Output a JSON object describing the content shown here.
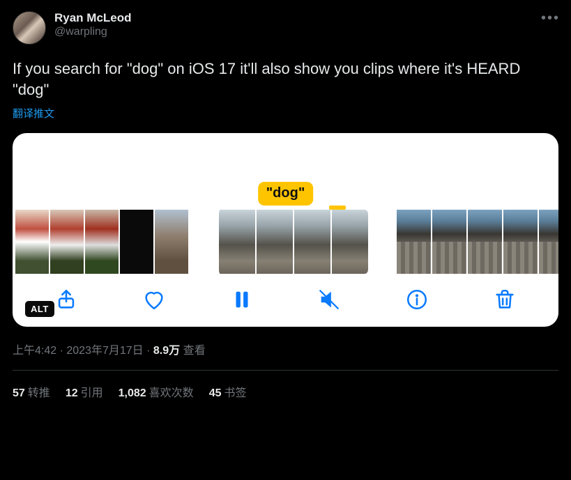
{
  "author": {
    "display_name": "Ryan McLeod",
    "handle": "@warpling"
  },
  "tweet_text": "If you search for \"dog\" on iOS 17 it'll also show you clips where it's HEARD \"dog\"",
  "translate_label": "翻译推文",
  "card": {
    "highlight_label": "\"dog\"",
    "alt_badge": "ALT",
    "toolbar": {
      "share": "share",
      "like": "like",
      "pause": "pause",
      "mute": "mute",
      "info": "info",
      "trash": "trash"
    }
  },
  "meta": {
    "time": "上午4:42",
    "sep": " · ",
    "date": "2023年7月17日",
    "views_number": "8.9万",
    "views_label": " 查看"
  },
  "stats": {
    "retweet_count": "57",
    "retweet_label": "转推",
    "quote_count": "12",
    "quote_label": "引用",
    "like_count": "1,082",
    "like_label": "喜欢次数",
    "bookmark_count": "45",
    "bookmark_label": "书签"
  }
}
